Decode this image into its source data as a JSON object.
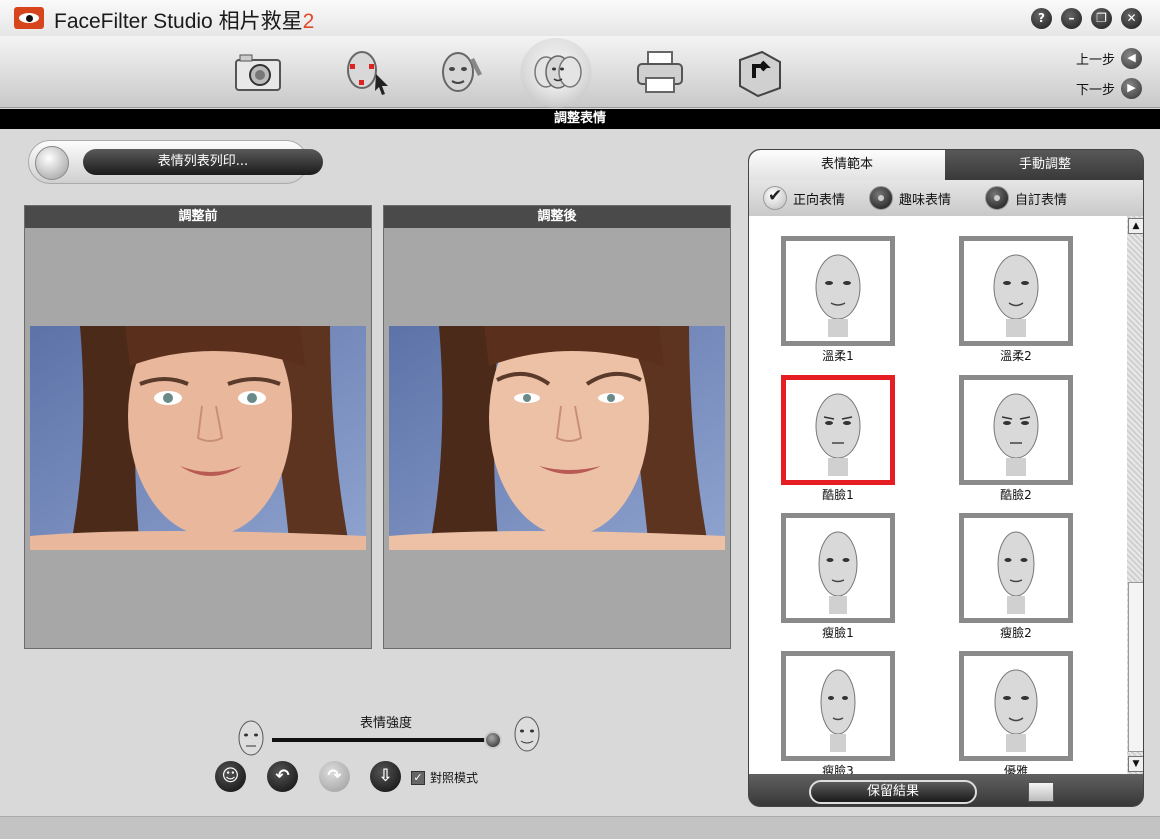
{
  "window": {
    "app_name": "FaceFilter Studio",
    "app_name_cjk": "相片救星",
    "version": "2",
    "buttons": [
      "?",
      "–",
      "❐",
      "✕"
    ]
  },
  "toolbar": {
    "tools": [
      {
        "name": "camera-icon"
      },
      {
        "name": "face-select-icon"
      },
      {
        "name": "face-edit-icon"
      },
      {
        "name": "expression-faces-icon"
      },
      {
        "name": "printer-icon"
      },
      {
        "name": "export-icon"
      }
    ],
    "prev_label": "上一步",
    "next_label": "下一步"
  },
  "section_title": "調整表情",
  "print_list_label": "表情列表列印...",
  "before_panel": {
    "title": "調整前"
  },
  "after_panel": {
    "title": "調整後"
  },
  "slider": {
    "label": "表情強度",
    "value": 1.0
  },
  "controls": {
    "compare_mode_label": "對照模式",
    "compare_checked": true
  },
  "right_panel": {
    "tabs": [
      "表情範本",
      "手動調整"
    ],
    "radios": [
      "正向表情",
      "趣味表情",
      "自訂表情"
    ],
    "selected_radio": 0,
    "templates": [
      "溫柔1",
      "溫柔2",
      "酷臉1",
      "酷臉2",
      "瘦臉1",
      "瘦臉2",
      "瘦臉3",
      "優雅"
    ],
    "selected_template": "酷臉1",
    "save_label": "保留結果"
  },
  "colors": {
    "selection": "#e61e24",
    "accent": "#e0482a"
  }
}
